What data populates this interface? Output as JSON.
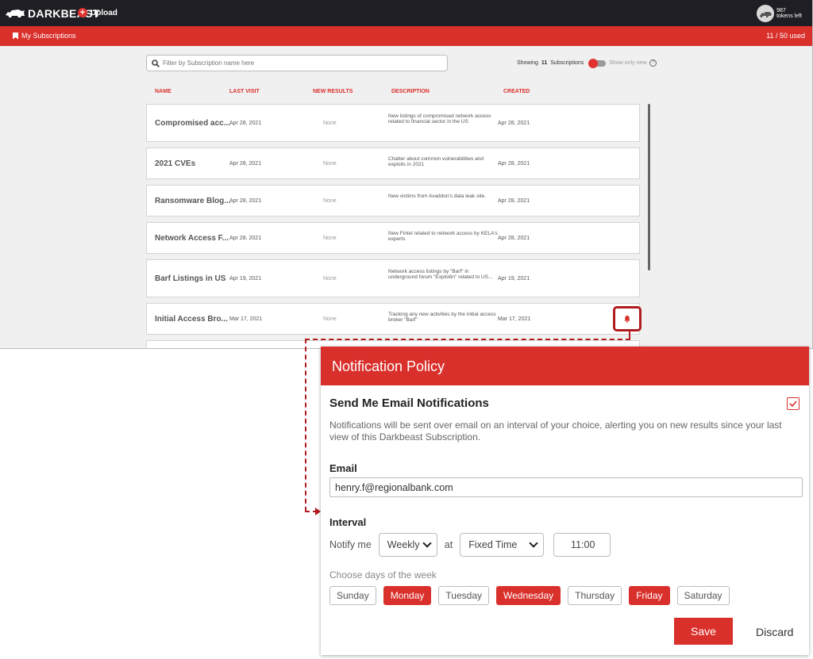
{
  "topbar": {
    "brand": "DARKBEAST",
    "upload_label": "Upload",
    "tokens_count": "987",
    "tokens_label": "tokens left"
  },
  "subbar": {
    "title": "My Subscriptions",
    "used": "11 / 50 used"
  },
  "filter": {
    "placeholder": "Filter by Subscription name here"
  },
  "showing": {
    "prefix": "Showing",
    "count": "11",
    "suffix": "Subscriptions",
    "show_only_new": "Show only new"
  },
  "table": {
    "columns": [
      "NAME",
      "LAST VISIT",
      "NEW RESULTS",
      "DESCRIPTION",
      "CREATED"
    ],
    "rows": [
      {
        "name": "Compromised acc...",
        "last_visit": "Apr 28, 2021",
        "new_results": "None",
        "description": "New listings of compromised network access related to financial sector in the US",
        "created": "Apr 28, 2021"
      },
      {
        "name": "2021 CVEs",
        "last_visit": "Apr 28, 2021",
        "new_results": "None",
        "description": "Chatter about common vulnerabilities and exploits in 2021",
        "created": "Apr 28, 2021"
      },
      {
        "name": "Ransomware Blog...",
        "last_visit": "Apr 28, 2021",
        "new_results": "None",
        "description": "New victims from Avaddon's data leak site.",
        "created": "Apr 28, 2021"
      },
      {
        "name": "Network Access F...",
        "last_visit": "Apr 28, 2021",
        "new_results": "None",
        "description": "New Fintel related to network access by KELA's experts",
        "created": "Apr 28, 2021"
      },
      {
        "name": "Barf Listings in US",
        "last_visit": "Apr 19, 2021",
        "new_results": "None",
        "description": "Network access listings by \"Barf\" in underground forum \"Exploitin\" related to US...",
        "created": "Apr 19, 2021"
      },
      {
        "name": "Initial Access Bro...",
        "last_visit": "Mar 17, 2021",
        "new_results": "None",
        "description": "Tracking any new activities by the initial access broker \"Barf\"",
        "created": "Mar 17, 2021"
      }
    ]
  },
  "dialog": {
    "title": "Notification Policy",
    "section_title": "Send Me Email Notifications",
    "checked": true,
    "description": "Notifications will be sent over email on an interval of your choice, alerting you on new results since your last view of this Darkbeast Subscription.",
    "email_label": "Email",
    "email_value": "henry.f@regionalbank.com",
    "interval_label": "Interval",
    "notify_me": "Notify me",
    "frequency": "Weekly",
    "at": "at",
    "time_mode": "Fixed Time",
    "time_value": "11:00",
    "choose_days": "Choose days of the week",
    "days": [
      {
        "label": "Sunday",
        "selected": false
      },
      {
        "label": "Monday",
        "selected": true
      },
      {
        "label": "Tuesday",
        "selected": false
      },
      {
        "label": "Wednesday",
        "selected": true
      },
      {
        "label": "Thursday",
        "selected": false
      },
      {
        "label": "Friday",
        "selected": true
      },
      {
        "label": "Saturday",
        "selected": false
      }
    ],
    "save_label": "Save",
    "discard_label": "Discard"
  },
  "colors": {
    "accent": "#d9302c",
    "highlight": "#b11c1f",
    "topbar": "#1e1e24"
  }
}
